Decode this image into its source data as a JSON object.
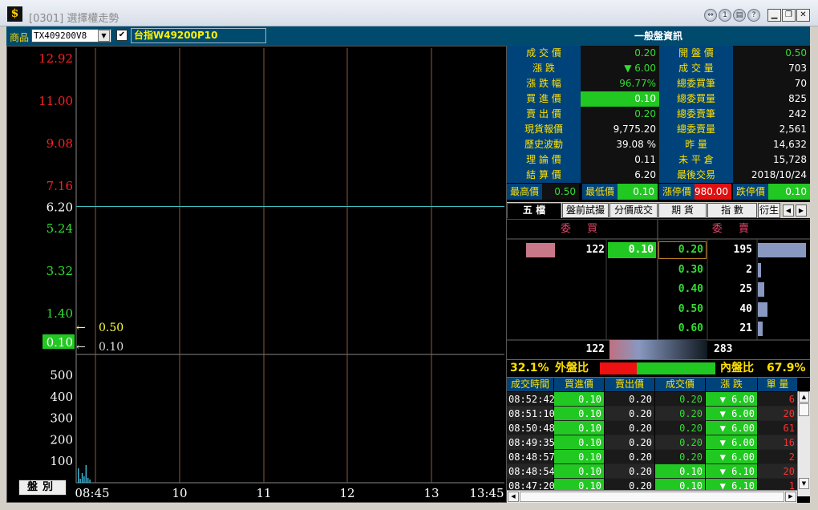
{
  "window": {
    "title": "[0301] 選擇權走勢"
  },
  "product": {
    "label": "商品",
    "code": "TX409200V8",
    "name": "台指W49200P10"
  },
  "chart_data": {
    "type": "line",
    "price_axis": [
      "12.92",
      "11.00",
      "9.08",
      "7.16",
      "6.20",
      "5.24",
      "3.32",
      "1.40",
      "0.10"
    ],
    "volume_axis": [
      "500",
      "400",
      "300",
      "200",
      "100"
    ],
    "x_labels": [
      "08:45",
      "10",
      "11",
      "12",
      "13",
      "13:45"
    ],
    "reference_price": "6.20",
    "markers": [
      {
        "label": "0.50",
        "value": 0.5
      },
      {
        "label": "0.10",
        "value": 0.1
      }
    ],
    "current_price_tag": "0.10",
    "volume_bars": [
      18,
      5,
      12,
      8,
      22,
      6,
      4
    ]
  },
  "switch_button": "盤別",
  "info": {
    "title": "一般盤資訊",
    "rows": [
      {
        "l1": "成 交 價",
        "v1": "0.20",
        "l2": "開 盤 價",
        "v2": "0.50"
      },
      {
        "l1": "漲    跌",
        "v1": "▼ 6.00",
        "l2": "成 交 量",
        "v2": "703"
      },
      {
        "l1": "漲 跌 幅",
        "v1": "96.77%",
        "l2": "總委買筆",
        "v2": "70"
      },
      {
        "l1": "買 進 價",
        "v1": "0.10",
        "l2": "總委買量",
        "v2": "825"
      },
      {
        "l1": "賣 出 價",
        "v1": "0.20",
        "l2": "總委賣筆",
        "v2": "242"
      },
      {
        "l1": "現貨報價",
        "v1": "9,775.20",
        "l2": "總委賣量",
        "v2": "2,561"
      },
      {
        "l1": "歷史波動",
        "v1": "39.08 %",
        "l2": "昨    量",
        "v2": "14,632"
      },
      {
        "l1": "理 論 價",
        "v1": "0.11",
        "l2": "未 平 倉",
        "v2": "15,728"
      },
      {
        "l1": "結 算 價",
        "v1": "6.20",
        "l2": "最後交易",
        "v2": "2018/10/24"
      }
    ],
    "limits": {
      "high_label": "最高價",
      "high": "0.50",
      "low_label": "最低價",
      "low": "0.10",
      "up_label": "漲停價",
      "up": "980.00",
      "down_label": "跌停價",
      "down": "0.10"
    }
  },
  "tabs": [
    "五 檔",
    "盤前試撮",
    "分價成交",
    "期 貨",
    "指 數",
    "衍生"
  ],
  "orderbook": {
    "bid_header": "委 買",
    "ask_header": "委 賣",
    "bids": [
      {
        "qty": "122",
        "price": "0.10"
      }
    ],
    "asks": [
      {
        "price": "0.20",
        "qty": "195"
      },
      {
        "price": "0.30",
        "qty": "2"
      },
      {
        "price": "0.40",
        "qty": "25"
      },
      {
        "price": "0.50",
        "qty": "40"
      },
      {
        "price": "0.60",
        "qty": "21"
      }
    ],
    "bid_total": "122",
    "ask_total": "283"
  },
  "ratio": {
    "outer_pct": "32.1%",
    "outer_label": "外盤比",
    "inner_label": "內盤比",
    "inner_pct": "67.9%"
  },
  "ticks": {
    "headers": [
      "成交時間",
      "買進價",
      "賣出價",
      "成交價",
      "漲 跌",
      "單 量"
    ],
    "rows": [
      {
        "time": "08:52:42",
        "bid": "0.10",
        "ask": "0.20",
        "price": "0.20",
        "chg": "▼ 6.00",
        "vol": "6"
      },
      {
        "time": "08:51:10",
        "bid": "0.10",
        "ask": "0.20",
        "price": "0.20",
        "chg": "▼ 6.00",
        "vol": "20"
      },
      {
        "time": "08:50:48",
        "bid": "0.10",
        "ask": "0.20",
        "price": "0.20",
        "chg": "▼ 6.00",
        "vol": "61"
      },
      {
        "time": "08:49:35",
        "bid": "0.10",
        "ask": "0.20",
        "price": "0.20",
        "chg": "▼ 6.00",
        "vol": "16"
      },
      {
        "time": "08:48:57",
        "bid": "0.10",
        "ask": "0.20",
        "price": "0.20",
        "chg": "▼ 6.00",
        "vol": "2"
      },
      {
        "time": "08:48:54",
        "bid": "0.10",
        "ask": "0.20",
        "price": "0.10",
        "chg": "▼ 6.10",
        "vol": "20"
      },
      {
        "time": "08:47:20",
        "bid": "0.10",
        "ask": "0.20",
        "price": "0.10",
        "chg": "▼ 6.10",
        "vol": "1"
      }
    ]
  }
}
